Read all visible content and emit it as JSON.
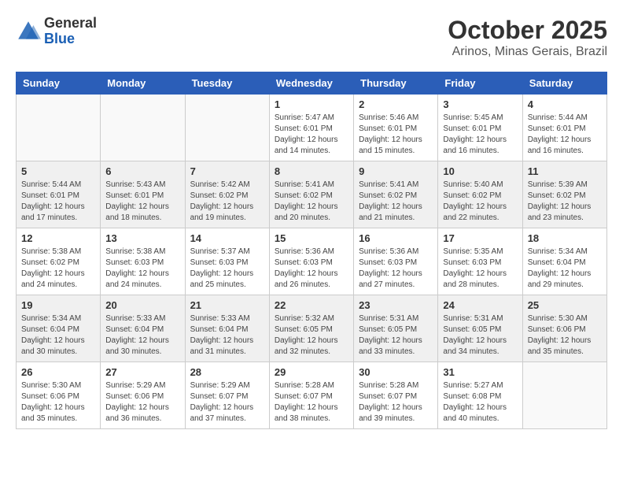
{
  "header": {
    "logo_line1": "General",
    "logo_line2": "Blue",
    "month": "October 2025",
    "location": "Arinos, Minas Gerais, Brazil"
  },
  "weekdays": [
    "Sunday",
    "Monday",
    "Tuesday",
    "Wednesday",
    "Thursday",
    "Friday",
    "Saturday"
  ],
  "weeks": [
    [
      {
        "day": "",
        "info": ""
      },
      {
        "day": "",
        "info": ""
      },
      {
        "day": "",
        "info": ""
      },
      {
        "day": "1",
        "info": "Sunrise: 5:47 AM\nSunset: 6:01 PM\nDaylight: 12 hours\nand 14 minutes."
      },
      {
        "day": "2",
        "info": "Sunrise: 5:46 AM\nSunset: 6:01 PM\nDaylight: 12 hours\nand 15 minutes."
      },
      {
        "day": "3",
        "info": "Sunrise: 5:45 AM\nSunset: 6:01 PM\nDaylight: 12 hours\nand 16 minutes."
      },
      {
        "day": "4",
        "info": "Sunrise: 5:44 AM\nSunset: 6:01 PM\nDaylight: 12 hours\nand 16 minutes."
      }
    ],
    [
      {
        "day": "5",
        "info": "Sunrise: 5:44 AM\nSunset: 6:01 PM\nDaylight: 12 hours\nand 17 minutes."
      },
      {
        "day": "6",
        "info": "Sunrise: 5:43 AM\nSunset: 6:01 PM\nDaylight: 12 hours\nand 18 minutes."
      },
      {
        "day": "7",
        "info": "Sunrise: 5:42 AM\nSunset: 6:02 PM\nDaylight: 12 hours\nand 19 minutes."
      },
      {
        "day": "8",
        "info": "Sunrise: 5:41 AM\nSunset: 6:02 PM\nDaylight: 12 hours\nand 20 minutes."
      },
      {
        "day": "9",
        "info": "Sunrise: 5:41 AM\nSunset: 6:02 PM\nDaylight: 12 hours\nand 21 minutes."
      },
      {
        "day": "10",
        "info": "Sunrise: 5:40 AM\nSunset: 6:02 PM\nDaylight: 12 hours\nand 22 minutes."
      },
      {
        "day": "11",
        "info": "Sunrise: 5:39 AM\nSunset: 6:02 PM\nDaylight: 12 hours\nand 23 minutes."
      }
    ],
    [
      {
        "day": "12",
        "info": "Sunrise: 5:38 AM\nSunset: 6:02 PM\nDaylight: 12 hours\nand 24 minutes."
      },
      {
        "day": "13",
        "info": "Sunrise: 5:38 AM\nSunset: 6:03 PM\nDaylight: 12 hours\nand 24 minutes."
      },
      {
        "day": "14",
        "info": "Sunrise: 5:37 AM\nSunset: 6:03 PM\nDaylight: 12 hours\nand 25 minutes."
      },
      {
        "day": "15",
        "info": "Sunrise: 5:36 AM\nSunset: 6:03 PM\nDaylight: 12 hours\nand 26 minutes."
      },
      {
        "day": "16",
        "info": "Sunrise: 5:36 AM\nSunset: 6:03 PM\nDaylight: 12 hours\nand 27 minutes."
      },
      {
        "day": "17",
        "info": "Sunrise: 5:35 AM\nSunset: 6:03 PM\nDaylight: 12 hours\nand 28 minutes."
      },
      {
        "day": "18",
        "info": "Sunrise: 5:34 AM\nSunset: 6:04 PM\nDaylight: 12 hours\nand 29 minutes."
      }
    ],
    [
      {
        "day": "19",
        "info": "Sunrise: 5:34 AM\nSunset: 6:04 PM\nDaylight: 12 hours\nand 30 minutes."
      },
      {
        "day": "20",
        "info": "Sunrise: 5:33 AM\nSunset: 6:04 PM\nDaylight: 12 hours\nand 30 minutes."
      },
      {
        "day": "21",
        "info": "Sunrise: 5:33 AM\nSunset: 6:04 PM\nDaylight: 12 hours\nand 31 minutes."
      },
      {
        "day": "22",
        "info": "Sunrise: 5:32 AM\nSunset: 6:05 PM\nDaylight: 12 hours\nand 32 minutes."
      },
      {
        "day": "23",
        "info": "Sunrise: 5:31 AM\nSunset: 6:05 PM\nDaylight: 12 hours\nand 33 minutes."
      },
      {
        "day": "24",
        "info": "Sunrise: 5:31 AM\nSunset: 6:05 PM\nDaylight: 12 hours\nand 34 minutes."
      },
      {
        "day": "25",
        "info": "Sunrise: 5:30 AM\nSunset: 6:06 PM\nDaylight: 12 hours\nand 35 minutes."
      }
    ],
    [
      {
        "day": "26",
        "info": "Sunrise: 5:30 AM\nSunset: 6:06 PM\nDaylight: 12 hours\nand 35 minutes."
      },
      {
        "day": "27",
        "info": "Sunrise: 5:29 AM\nSunset: 6:06 PM\nDaylight: 12 hours\nand 36 minutes."
      },
      {
        "day": "28",
        "info": "Sunrise: 5:29 AM\nSunset: 6:07 PM\nDaylight: 12 hours\nand 37 minutes."
      },
      {
        "day": "29",
        "info": "Sunrise: 5:28 AM\nSunset: 6:07 PM\nDaylight: 12 hours\nand 38 minutes."
      },
      {
        "day": "30",
        "info": "Sunrise: 5:28 AM\nSunset: 6:07 PM\nDaylight: 12 hours\nand 39 minutes."
      },
      {
        "day": "31",
        "info": "Sunrise: 5:27 AM\nSunset: 6:08 PM\nDaylight: 12 hours\nand 40 minutes."
      },
      {
        "day": "",
        "info": ""
      }
    ]
  ]
}
